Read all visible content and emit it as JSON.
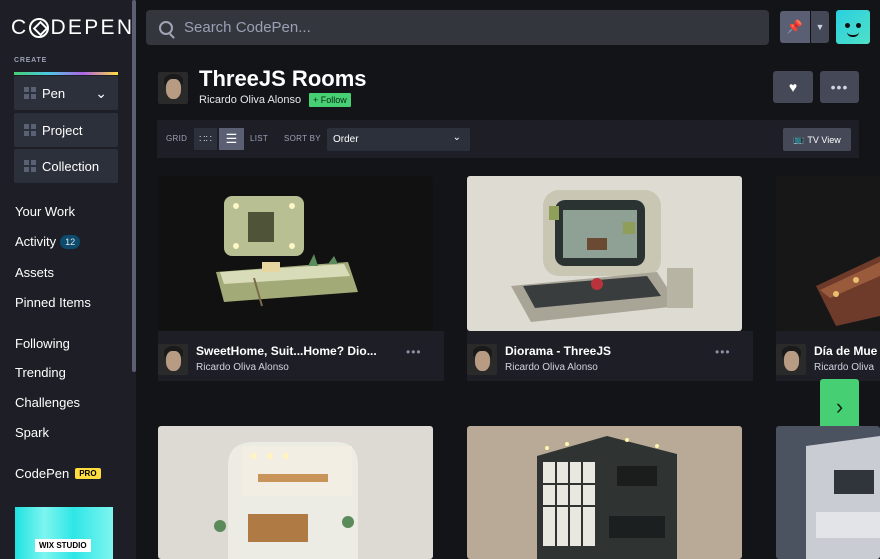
{
  "brand": {
    "logo_text_1": "C",
    "logo_text_2": "DEPEN"
  },
  "sidebar": {
    "create_label": "CREATE",
    "create_buttons": [
      {
        "label": "Pen"
      },
      {
        "label": "Project"
      },
      {
        "label": "Collection"
      }
    ],
    "nav": [
      {
        "label": "Your Work"
      },
      {
        "label": "Activity",
        "badge": "12"
      },
      {
        "label": "Assets"
      },
      {
        "label": "Pinned Items"
      },
      {
        "label": "Following"
      },
      {
        "label": "Trending"
      },
      {
        "label": "Challenges"
      },
      {
        "label": "Spark"
      },
      {
        "label": "CodePen",
        "badge": "PRO"
      }
    ],
    "ad_text": "WIX STUDIO"
  },
  "search": {
    "placeholder": "Search CodePen..."
  },
  "collection": {
    "title": "ThreeJS Rooms",
    "author": "Ricardo Oliva Alonso",
    "follow_label": "+ Follow"
  },
  "toolbar": {
    "grid_label": "GRID",
    "list_label": "LIST",
    "sort_label": "SORT BY",
    "sort_value": "Order",
    "tv_label": "TV View"
  },
  "cards": [
    {
      "title": "SweetHome, Suit...Home? Dio...",
      "author": "Ricardo Oliva Alonso"
    },
    {
      "title": "Diorama - ThreeJS",
      "author": "Ricardo Oliva Alonso"
    },
    {
      "title": "Día de Mue",
      "author": "Ricardo Oliva"
    }
  ],
  "colors": {
    "accent_green": "#47cf73",
    "pro_yellow": "#ffdd40",
    "bg": "#131417",
    "panel": "#1e1f26"
  }
}
